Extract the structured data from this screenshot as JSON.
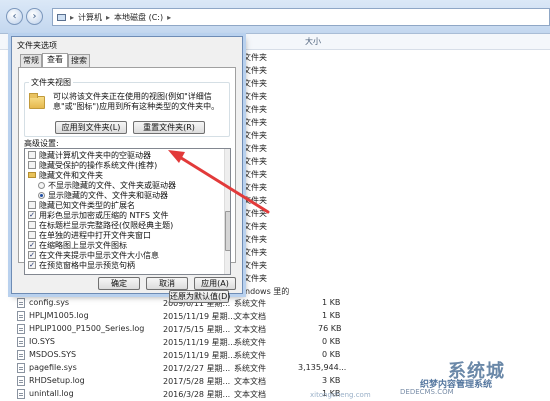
{
  "explorer": {
    "breadcrumb": [
      "计算机",
      "本地磁盘 (C:)"
    ],
    "columns": {
      "size": "大小"
    },
    "type_fragments": [
      "文件夹",
      "文件夹",
      "文件夹",
      "文件夹",
      "文件夹",
      "文件夹",
      "文件夹",
      "文件夹",
      "文件夹",
      "文件夹",
      "文件夹",
      "文件夹",
      "文件夹",
      "文件夹",
      "文件夹",
      "文件夹",
      "文件夹",
      "文件夹"
    ],
    "windows_fragment": "ndows 里的",
    "files": [
      {
        "name": "config.sys",
        "date": "2009/6/11 星期...",
        "type": "系统文件",
        "size": "1 KB"
      },
      {
        "name": "HPLJM1005.log",
        "date": "2015/11/19 星期...",
        "type": "文本文档",
        "size": "1 KB"
      },
      {
        "name": "HPLIP1000_P1500_Series.log",
        "date": "2017/5/15 星期...",
        "type": "文本文档",
        "size": "76 KB"
      },
      {
        "name": "IO.SYS",
        "date": "2015/11/19 星期...",
        "type": "系统文件",
        "size": "0 KB"
      },
      {
        "name": "MSDOS.SYS",
        "date": "2015/11/19 星期...",
        "type": "系统文件",
        "size": "0 KB"
      },
      {
        "name": "pagefile.sys",
        "date": "2017/2/27 星期...",
        "type": "系统文件",
        "size": "3,135,944..."
      },
      {
        "name": "RHDSetup.log",
        "date": "2017/5/28 星期...",
        "type": "文本文档",
        "size": "3 KB"
      },
      {
        "name": "unintall.log",
        "date": "2016/3/28 星期...",
        "type": "文本文档",
        "size": "1 KB"
      }
    ]
  },
  "dialog": {
    "title": "文件夹选项",
    "tabs": [
      "常规",
      "查看",
      "搜索"
    ],
    "active_tab": 1,
    "folder_view": {
      "group_label": "文件夹视图",
      "description": "可以将该文件夹正在使用的视图(例如\"详细信息\"或\"图标\")应用到所有这种类型的文件夹中。",
      "apply_button": "应用到文件夹(L)",
      "reset_button": "重置文件夹(R)"
    },
    "advanced": {
      "group_label": "高级设置:",
      "items": [
        {
          "kind": "check",
          "label": "隐藏计算机文件夹中的空驱动器",
          "checked": false
        },
        {
          "kind": "check",
          "label": "隐藏受保护的操作系统文件(推荐)",
          "checked": false
        },
        {
          "kind": "folder",
          "label": "隐藏文件和文件夹"
        },
        {
          "kind": "radio",
          "label": "不显示隐藏的文件、文件夹或驱动器",
          "checked": false
        },
        {
          "kind": "radio",
          "label": "显示隐藏的文件、文件夹和驱动器",
          "checked": true
        },
        {
          "kind": "check",
          "label": "隐藏已知文件类型的扩展名",
          "checked": false
        },
        {
          "kind": "check",
          "label": "用彩色显示加密或压缩的 NTFS 文件",
          "checked": true
        },
        {
          "kind": "check",
          "label": "在标题栏显示完整路径(仅限经典主题)",
          "checked": false
        },
        {
          "kind": "check",
          "label": "在单独的进程中打开文件夹窗口",
          "checked": false
        },
        {
          "kind": "check",
          "label": "在缩略图上显示文件图标",
          "checked": true
        },
        {
          "kind": "check",
          "label": "在文件夹提示中显示文件大小信息",
          "checked": true
        },
        {
          "kind": "check",
          "label": "在预览窗格中显示预览句柄",
          "checked": true
        }
      ],
      "restore_button": "还原为默认值(D)"
    },
    "footer": {
      "ok": "确定",
      "cancel": "取消",
      "apply": "应用(A)"
    }
  },
  "watermark": {
    "logo": "系统城",
    "site": "织梦内容管理系统",
    "url": "DEDECMS.COM",
    "url2": "xitongcheng.com"
  }
}
